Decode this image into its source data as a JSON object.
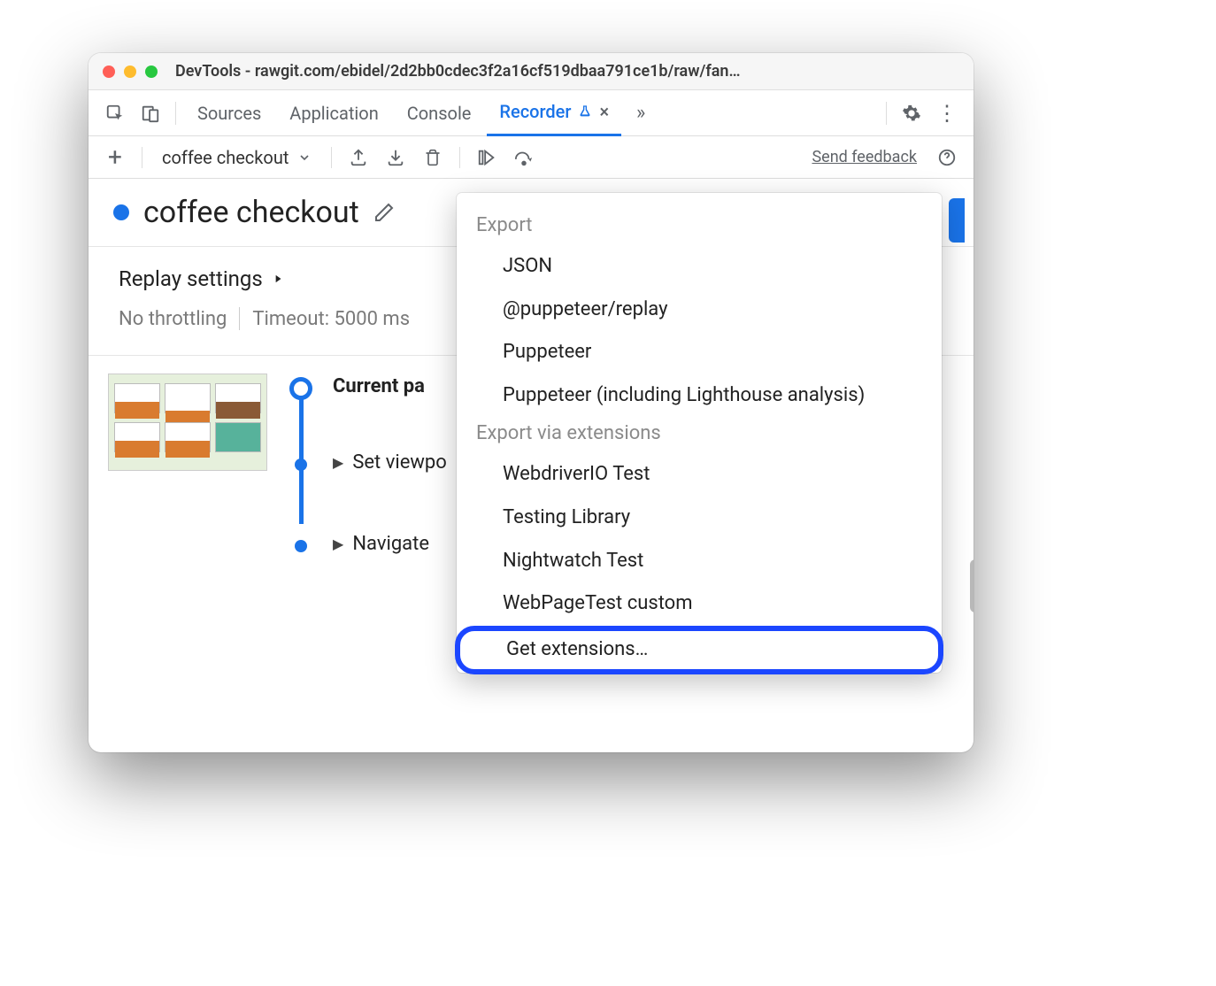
{
  "window": {
    "title": "DevTools - rawgit.com/ebidel/2d2bb0cdec3f2a16cf519dbaa791ce1b/raw/fan…"
  },
  "tabs": {
    "sources": "Sources",
    "application": "Application",
    "console": "Console",
    "recorder": "Recorder"
  },
  "toolbar": {
    "recording_name": "coffee checkout",
    "feedback": "Send feedback"
  },
  "recording": {
    "title": "coffee checkout"
  },
  "replay": {
    "label": "Replay settings",
    "throttle": "No throttling",
    "timeout": "Timeout: 5000 ms"
  },
  "steps": {
    "current": "Current pa",
    "setviewport": "Set viewpo",
    "navigate": "Navigate"
  },
  "dropdown": {
    "section1": "Export",
    "json": "JSON",
    "replay": "@puppeteer/replay",
    "puppeteer": "Puppeteer",
    "lighthouse": "Puppeteer (including Lighthouse analysis)",
    "section2": "Export via extensions",
    "wdio": "WebdriverIO Test",
    "testinglib": "Testing Library",
    "nightwatch": "Nightwatch Test",
    "wpt": "WebPageTest custom",
    "getext": "Get extensions…"
  }
}
